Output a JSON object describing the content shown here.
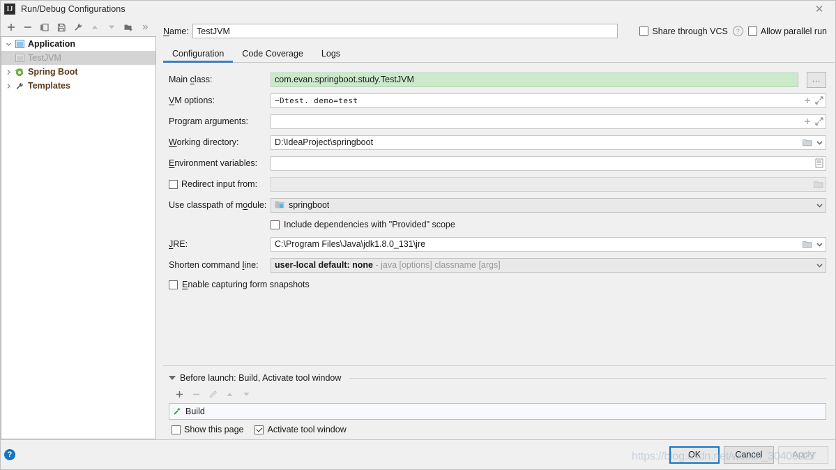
{
  "window": {
    "title": "Run/Debug Configurations",
    "app_icon": "idea-icon",
    "close_label": "✕"
  },
  "left_toolbar": {
    "buttons": [
      {
        "name": "add-configuration-button",
        "icon": "plus-icon",
        "label": "+"
      },
      {
        "name": "remove-configuration-button",
        "icon": "minus-icon",
        "label": "−"
      },
      {
        "name": "copy-configuration-button",
        "icon": "copy-icon",
        "label": "Copy"
      },
      {
        "name": "save-configuration-button",
        "icon": "save-icon",
        "label": "Save"
      },
      {
        "name": "edit-defaults-button",
        "icon": "wrench-icon",
        "label": "Edit defaults"
      },
      {
        "name": "move-up-button",
        "icon": "arrow-up-icon",
        "label": "Move Up"
      },
      {
        "name": "move-down-button",
        "icon": "arrow-down-icon",
        "label": "Move Down"
      },
      {
        "name": "new-folder-button",
        "icon": "new-folder-icon",
        "label": "New Folder"
      },
      {
        "name": "more-options-button",
        "icon": "chevron-double-right-icon",
        "label": "»"
      }
    ]
  },
  "tree": {
    "items": [
      {
        "label": "Application",
        "icon": "application-icon",
        "expander": "chevron-down-icon",
        "style": "bold",
        "indent": 0,
        "selected": false
      },
      {
        "label": "TestJVM",
        "icon": "application-icon",
        "expander": "",
        "style": "dim",
        "indent": 1,
        "selected": true
      },
      {
        "label": "Spring Boot",
        "icon": "spring-boot-icon",
        "expander": "chevron-right-icon",
        "style": "brown",
        "indent": 0,
        "selected": false
      },
      {
        "label": "Templates",
        "icon": "wrench-icon",
        "expander": "chevron-right-icon",
        "style": "brown",
        "indent": 0,
        "selected": false
      }
    ]
  },
  "name_row": {
    "label": "Name:",
    "label_mnemonic": "N",
    "value": "TestJVM",
    "share_through_vcs": {
      "label": "Share through VCS",
      "checked": false,
      "help_icon": "question-circle-icon",
      "help_label": "?"
    },
    "allow_parallel_run": {
      "label": "Allow parallel run",
      "checked": false
    }
  },
  "tabs": [
    {
      "label": "Configuration",
      "active": true
    },
    {
      "label": "Code Coverage",
      "active": false
    },
    {
      "label": "Logs",
      "active": false
    }
  ],
  "form": {
    "main_class": {
      "label": "Main class:",
      "value": "com.evan.springboot.study.TestJVM",
      "browse_button": "...",
      "browse_icon": "ellipsis-icon"
    },
    "vm_options": {
      "label": "VM options:",
      "value": "−Dtest. demo=test",
      "icons": [
        "plus-icon",
        "expand-icon"
      ]
    },
    "program_arguments": {
      "label": "Program arguments:",
      "value": "",
      "icons": [
        "plus-icon",
        "expand-icon"
      ]
    },
    "working_directory": {
      "label": "Working directory:",
      "value": "D:\\IdeaProject\\springboot",
      "icons": [
        "folder-icon",
        "chevron-down-icon"
      ]
    },
    "environment_variables": {
      "label": "Environment variables:",
      "value": "",
      "icons": [
        "list-icon"
      ]
    },
    "redirect_input_from": {
      "label": "Redirect input from:",
      "checked": false,
      "value": "",
      "icons": [
        "folder-icon"
      ]
    },
    "use_classpath_of_module": {
      "label": "Use classpath of module:",
      "value": "springboot",
      "value_icon": "module-icon",
      "icons": [
        "chevron-down-icon"
      ]
    },
    "include_provided": {
      "label": "Include dependencies with \"Provided\" scope",
      "checked": false
    },
    "jre": {
      "label": "JRE:",
      "value": "C:\\Program Files\\Java\\jdk1.8.0_131\\jre",
      "icons": [
        "folder-icon",
        "chevron-down-icon"
      ]
    },
    "shorten_command_line": {
      "label": "Shorten command line:",
      "value": "user-local default: none",
      "value_hint": " - java [options] classname [args]",
      "icons": [
        "chevron-down-icon"
      ]
    },
    "enable_capturing_form_snapshots": {
      "label": "Enable capturing form snapshots",
      "checked": false
    }
  },
  "before_launch": {
    "title": "Before launch: Build, Activate tool window",
    "expander": "triangle-down-icon",
    "toolbar": [
      {
        "name": "add-task-button",
        "icon": "plus-icon",
        "label": "+",
        "enabled": true
      },
      {
        "name": "remove-task-button",
        "icon": "minus-icon",
        "label": "−",
        "enabled": false
      },
      {
        "name": "edit-task-button",
        "icon": "pencil-icon",
        "label": "Edit",
        "enabled": false
      },
      {
        "name": "move-task-up-button",
        "icon": "arrow-up-icon",
        "label": "Up",
        "enabled": false
      },
      {
        "name": "move-task-down-button",
        "icon": "arrow-down-icon",
        "label": "Down",
        "enabled": false
      }
    ],
    "tasks": [
      {
        "label": "Build",
        "icon": "build-hammer-icon"
      }
    ],
    "show_this_page": {
      "label": "Show this page",
      "checked": false
    },
    "activate_tool_window": {
      "label": "Activate tool window",
      "checked": true
    }
  },
  "bottom": {
    "help_icon": "help-circle-icon",
    "help_label": "?",
    "buttons": [
      {
        "name": "ok-button",
        "label": "OK",
        "style": "default"
      },
      {
        "name": "cancel-button",
        "label": "Cancel",
        "style": "normal"
      },
      {
        "name": "apply-button",
        "label": "Apply",
        "style": "disabled"
      }
    ]
  },
  "watermark": {
    "text": "https://blog.csdn.net/weixin_30409927"
  },
  "colors": {
    "accent": "#3d7ec2",
    "help_blue": "#1475c4",
    "green_field": "#cbe9cb",
    "dialog_bg": "#f0f0f0",
    "tree_selection": "#d4d4d4",
    "brown_text": "#5c3b17",
    "build_icon_green": "#49a05b"
  }
}
